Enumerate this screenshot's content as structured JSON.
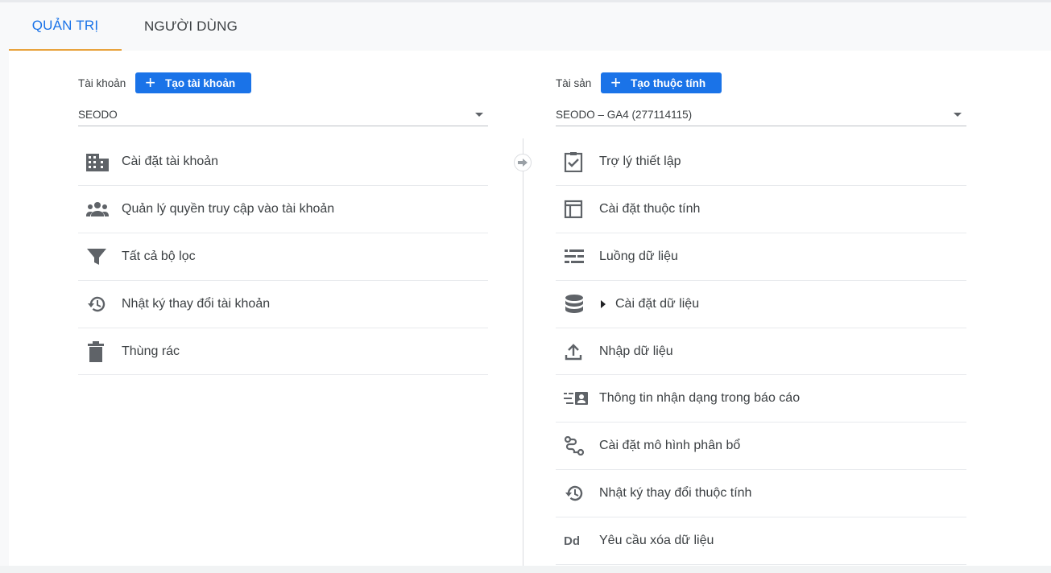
{
  "tabs": [
    {
      "label": "QUẢN TRỊ",
      "active": true
    },
    {
      "label": "NGƯỜI DÙNG",
      "active": false
    }
  ],
  "account": {
    "label": "Tài khoản",
    "create_button": "Tạo tài khoản",
    "selected": "SEODO",
    "items": [
      {
        "icon": "building-icon",
        "label": "Cài đặt tài khoản"
      },
      {
        "icon": "people-icon",
        "label": "Quản lý quyền truy cập vào tài khoản"
      },
      {
        "icon": "filter-icon",
        "label": "Tất cả bộ lọc"
      },
      {
        "icon": "history-icon",
        "label": "Nhật ký thay đổi tài khoản"
      },
      {
        "icon": "trash-icon",
        "label": "Thùng rác"
      }
    ]
  },
  "property": {
    "label": "Tài sản",
    "create_button": "Tạo thuộc tính",
    "selected": "SEODO – GA4 (277114115)",
    "items": [
      {
        "icon": "clipboard-check-icon",
        "label": "Trợ lý thiết lập"
      },
      {
        "icon": "layout-icon",
        "label": "Cài đặt thuộc tính"
      },
      {
        "icon": "data-streams-icon",
        "label": "Luồng dữ liệu"
      },
      {
        "icon": "database-icon",
        "label": "Cài đặt dữ liệu"
      },
      {
        "icon": "upload-icon",
        "label": "Nhập dữ liệu"
      },
      {
        "icon": "reporting-identity-icon",
        "label": "Thông tin nhận dạng trong báo cáo"
      },
      {
        "icon": "attribution-icon",
        "label": "Cài đặt mô hình phân bổ"
      },
      {
        "icon": "history-icon",
        "label": "Nhật ký thay đổi thuộc tính"
      },
      {
        "icon": "dd-icon",
        "icon_text": "Dd",
        "label": "Yêu cầu xóa dữ liệu"
      }
    ]
  },
  "colors": {
    "primary": "#1a73e8",
    "tab_underline": "#e8a33d",
    "icon": "#5f6368"
  }
}
